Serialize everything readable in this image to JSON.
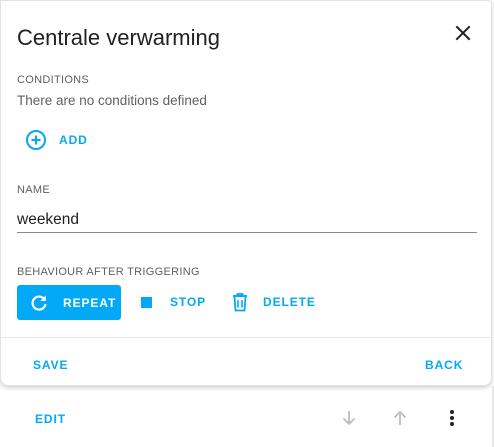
{
  "dialog": {
    "title": "Centrale verwarming",
    "conditions": {
      "label": "CONDITIONS",
      "empty_text": "There are no conditions defined",
      "add_label": "ADD"
    },
    "name": {
      "label": "NAME",
      "value": "weekend"
    },
    "behaviour": {
      "label": "BEHAVIOUR AFTER TRIGGERING",
      "repeat_label": "REPEAT",
      "stop_label": "STOP",
      "delete_label": "DELETE",
      "selected": "REPEAT"
    },
    "footer": {
      "save_label": "SAVE",
      "back_label": "BACK"
    }
  },
  "card_actions": {
    "edit_label": "EDIT"
  },
  "icons": {
    "close": "close-icon",
    "add": "add-circle-icon",
    "repeat": "refresh-icon",
    "stop": "stop-icon",
    "delete": "trash-icon",
    "move_down": "arrow-down-icon",
    "move_up": "arrow-up-icon",
    "more": "dots-vertical-icon"
  },
  "colors": {
    "accent": "#03a9f4",
    "text": "#212121",
    "secondary_text": "#616161",
    "disabled_icon": "#bdbdbd"
  }
}
